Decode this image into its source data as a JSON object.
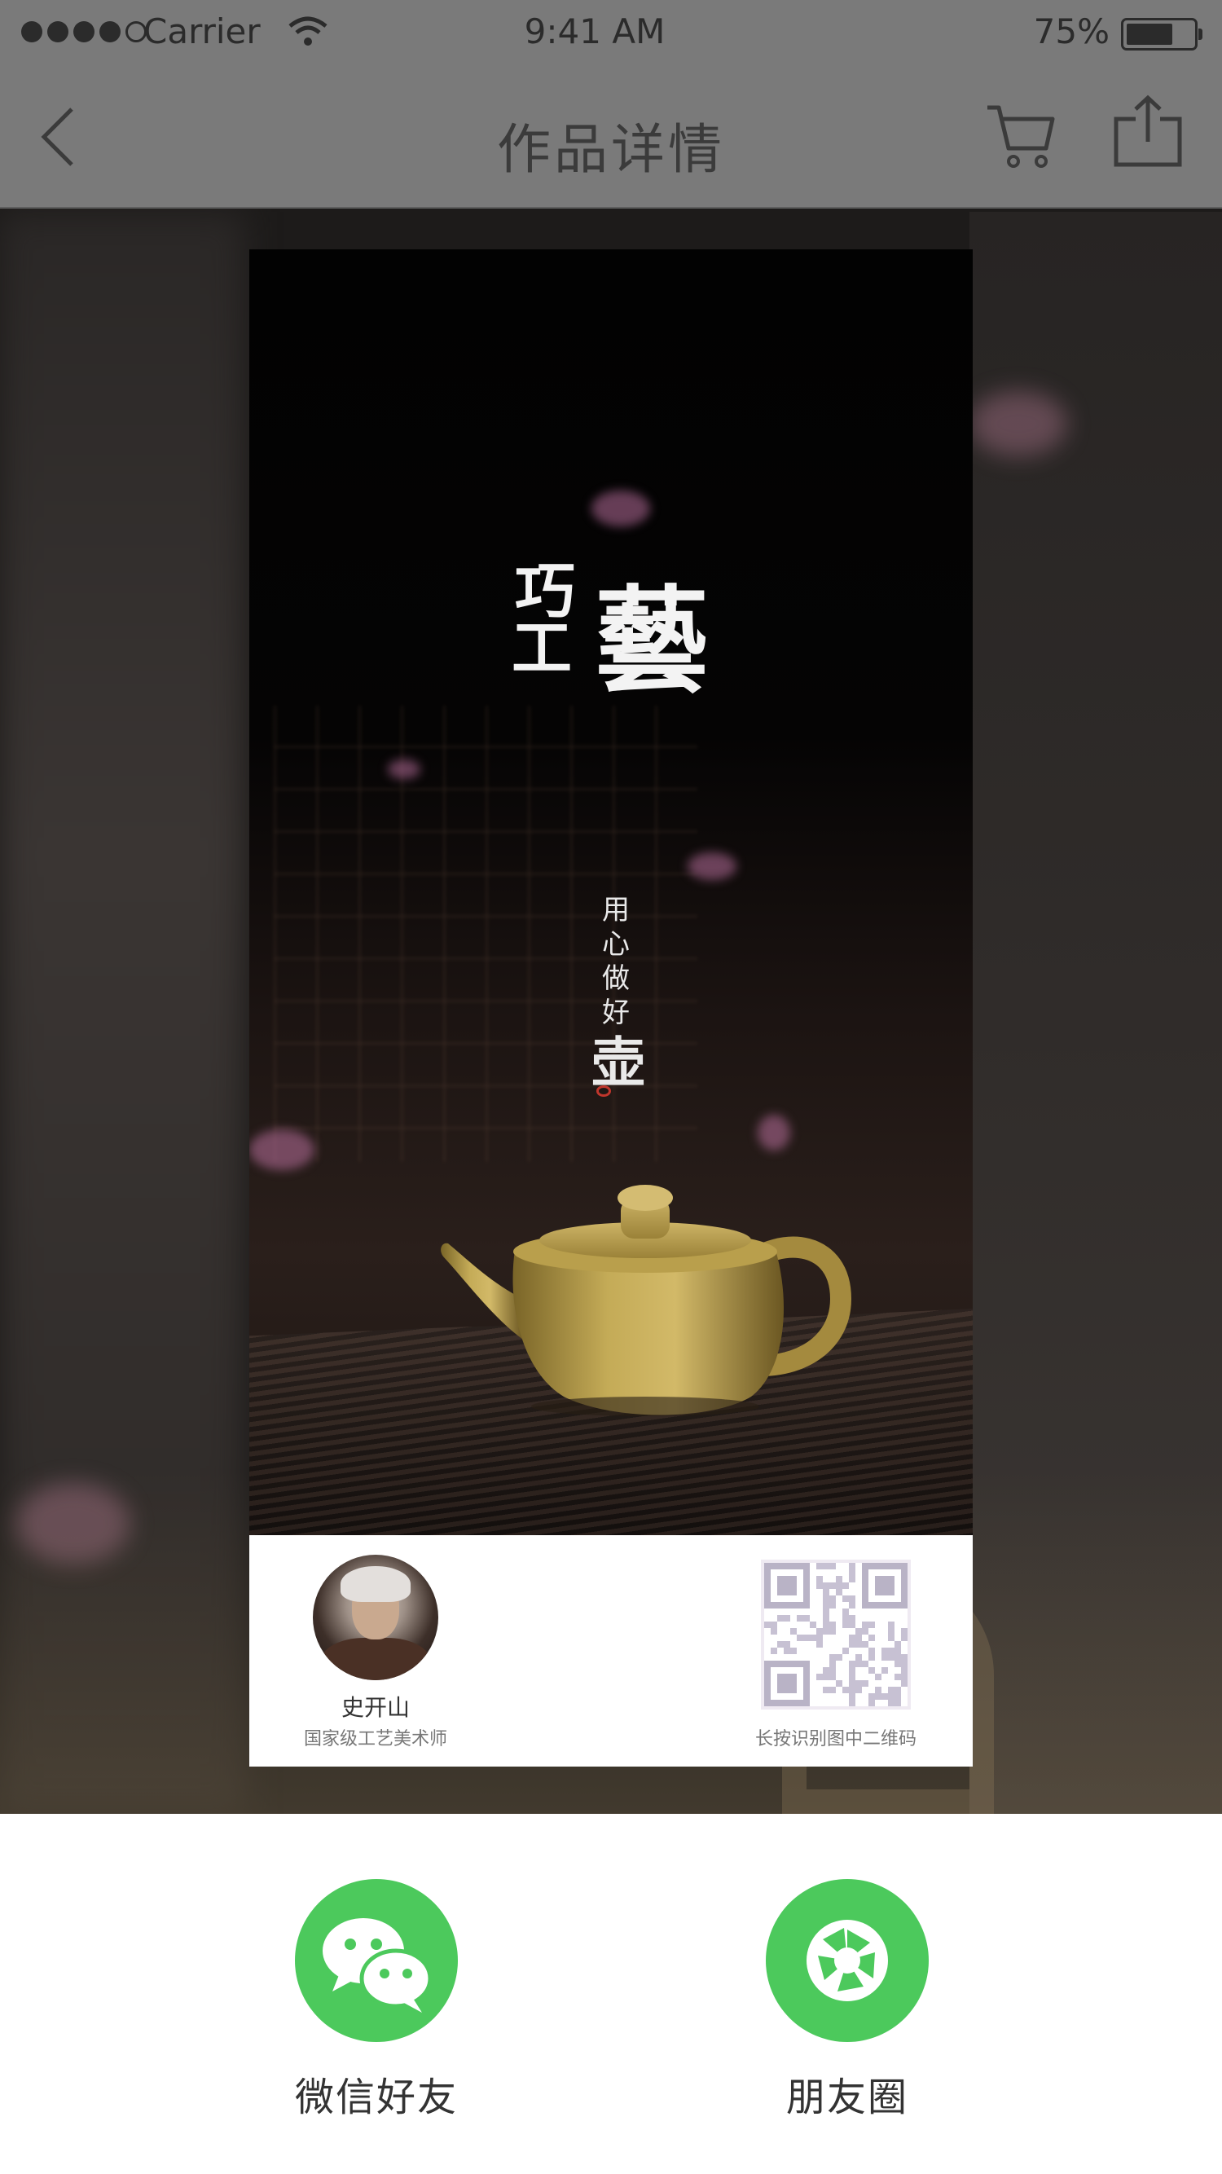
{
  "status_bar": {
    "carrier": "Carrier",
    "time": "9:41 AM",
    "battery_percent": "75%",
    "battery_level": 0.75,
    "signal_bars": 4
  },
  "nav_bar": {
    "title": "作品详情",
    "back_icon": "chevron-left-icon",
    "cart_icon": "cart-icon",
    "share_icon": "share-icon"
  },
  "poster": {
    "headline_small_top": "巧",
    "headline_small_bottom": "工",
    "headline_large": "藝",
    "motto": [
      "用",
      "心",
      "做",
      "好"
    ],
    "motto_emphasis": "壶",
    "artist": {
      "name": "史开山",
      "title": "国家级工艺美术师"
    },
    "qr_caption": "长按识别图中二维码"
  },
  "share_sheet": {
    "options": [
      {
        "label": "微信好友",
        "icon": "wechat-icon",
        "color": "#4cc95c"
      },
      {
        "label": "朋友圈",
        "icon": "moments-icon",
        "color": "#4cc95c"
      }
    ]
  }
}
